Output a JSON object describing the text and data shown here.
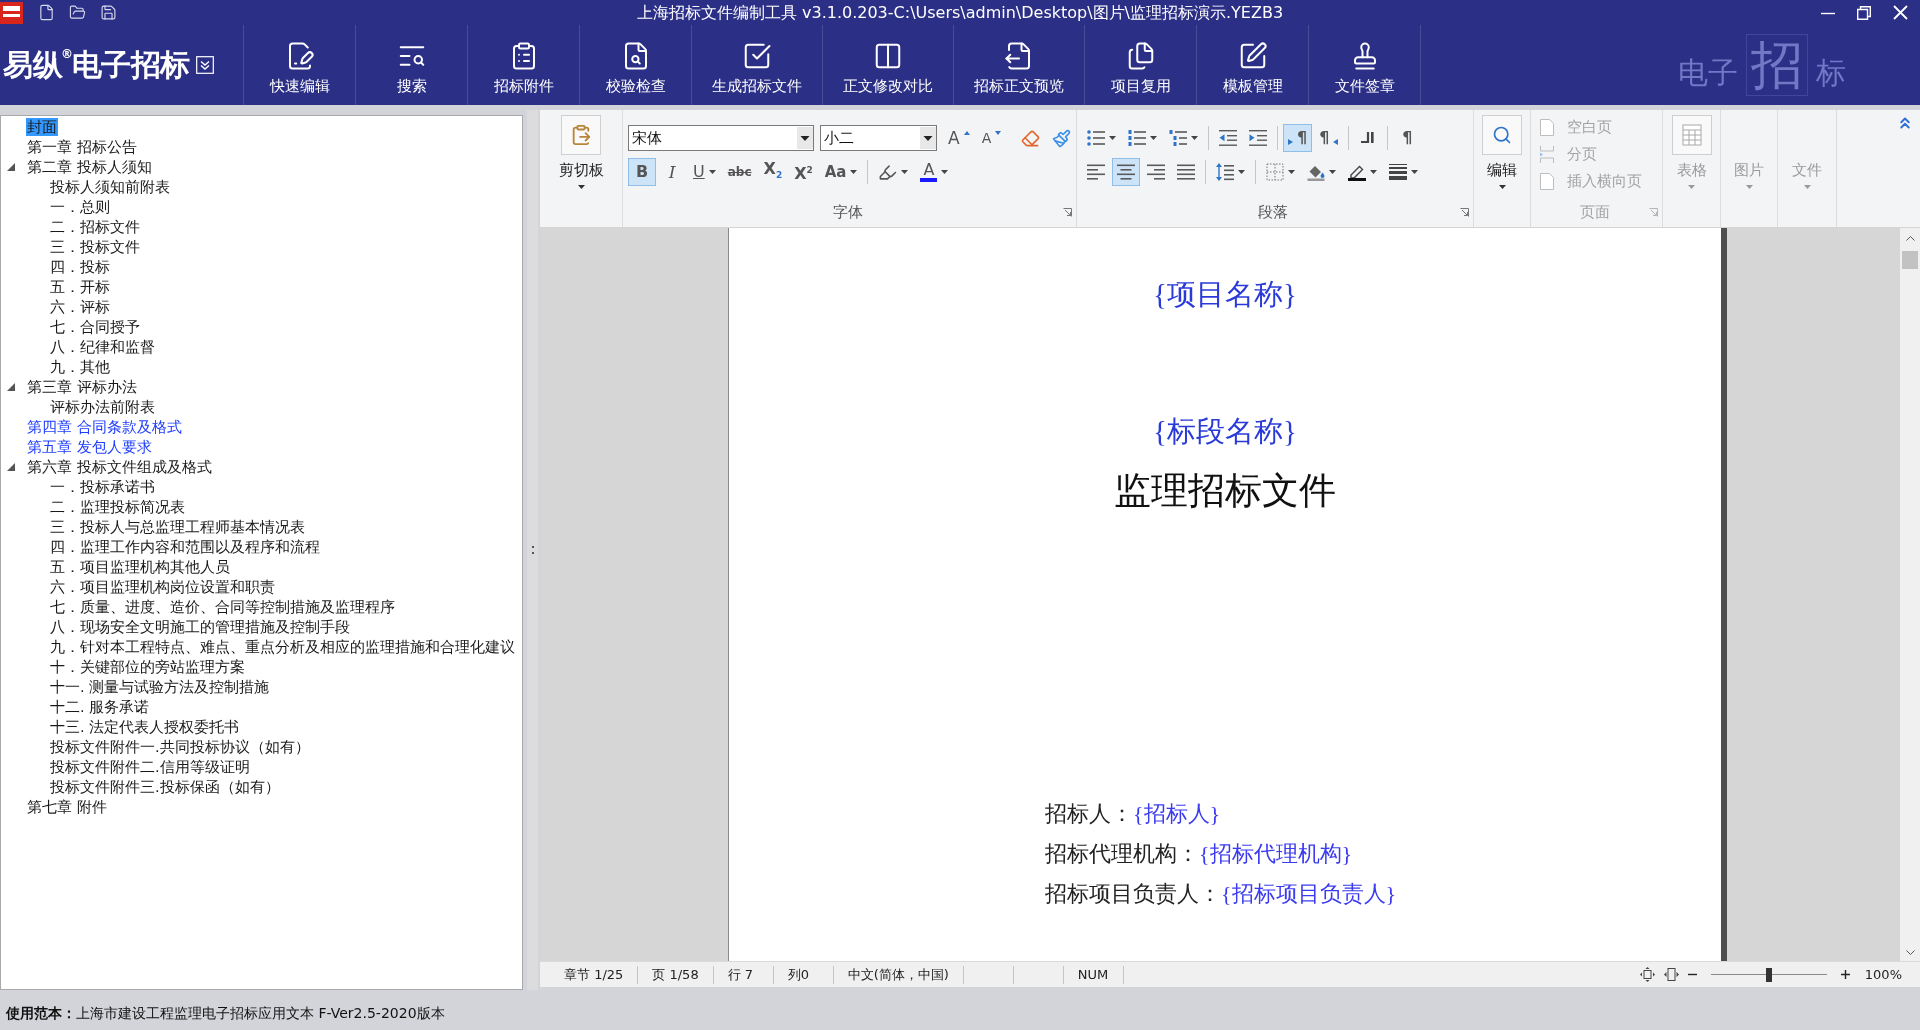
{
  "window": {
    "title": "上海招标文件编制工具 v3.1.0.203-C:\\Users\\admin\\Desktop\\图片\\监理招标演示.YEZB3"
  },
  "brand": {
    "name": "易纵$^{®}$电子招标",
    "mark": [
      "电子",
      "招",
      "标"
    ]
  },
  "toolbar": [
    {
      "kind": "quick-edit",
      "label": "快速编辑"
    },
    {
      "kind": "search",
      "label": "搜索"
    },
    {
      "kind": "attachment",
      "label": "招标附件"
    },
    {
      "kind": "check",
      "label": "校验检查"
    },
    {
      "kind": "generate",
      "label": "生成招标文件"
    },
    {
      "kind": "compare",
      "label": "正文修改对比"
    },
    {
      "kind": "preview",
      "label": "招标正文预览"
    },
    {
      "kind": "reuse",
      "label": "项目复用"
    },
    {
      "kind": "template",
      "label": "模板管理"
    },
    {
      "kind": "sign",
      "label": "文件签章"
    }
  ],
  "tree": {
    "items": [
      {
        "label": "封面",
        "selected": true
      },
      {
        "label": "第一章 招标公告",
        "selected": false
      },
      {
        "label": "第二章 投标人须知",
        "selected": false,
        "expanded": true,
        "children": [
          {
            "label": "投标人须知前附表",
            "selected": false
          },
          {
            "label": "一．总则",
            "selected": false
          },
          {
            "label": "二．招标文件",
            "selected": false
          },
          {
            "label": "三．投标文件",
            "selected": false
          },
          {
            "label": "四．投标",
            "selected": false
          },
          {
            "label": "五．开标",
            "selected": false
          },
          {
            "label": "六．评标",
            "selected": false
          },
          {
            "label": "七．合同授予",
            "selected": false
          },
          {
            "label": "八．纪律和监督",
            "selected": false
          },
          {
            "label": "九．其他",
            "selected": false
          }
        ]
      },
      {
        "label": "第三章 评标办法",
        "selected": false,
        "expanded": true,
        "children": [
          {
            "label": "评标办法前附表",
            "selected": false
          }
        ]
      },
      {
        "label": "第四章 合同条款及格式",
        "selected": false,
        "color": "#1e3cff"
      },
      {
        "label": "第五章 发包人要求",
        "selected": false,
        "color": "#1e3cff"
      },
      {
        "label": "第六章 投标文件组成及格式",
        "selected": false,
        "expanded": true,
        "children": [
          {
            "label": "一．投标承诺书",
            "selected": false
          },
          {
            "label": "二．监理投标简况表",
            "selected": false
          },
          {
            "label": "三．投标人与总监理工程师基本情况表",
            "selected": false
          },
          {
            "label": "四．监理工作内容和范围以及程序和流程",
            "selected": false
          },
          {
            "label": "五．项目监理机构其他人员",
            "selected": false
          },
          {
            "label": "六．项目监理机构岗位设置和职责",
            "selected": false
          },
          {
            "label": "七．质量、进度、造价、合同等控制措施及监理程序",
            "selected": false
          },
          {
            "label": "八．现场安全文明施工的管理措施及控制手段",
            "selected": false
          },
          {
            "label": "九．针对本工程特点、难点、重点分析及相应的监理措施和合理化建议",
            "selected": false
          },
          {
            "label": "十．关键部位的旁站监理方案",
            "selected": false
          },
          {
            "label": "十一. 测量与试验方法及控制措施",
            "selected": false
          },
          {
            "label": "十二. 服务承诺",
            "selected": false
          },
          {
            "label": "十三. 法定代表人授权委托书",
            "selected": false
          },
          {
            "label": "投标文件附件一.共同投标协议（如有）",
            "selected": false
          },
          {
            "label": "投标文件附件二.信用等级证明",
            "selected": false
          },
          {
            "label": "投标文件附件三.投标保函（如有）",
            "selected": false
          }
        ]
      },
      {
        "label": "第七章 附件",
        "selected": false
      }
    ]
  },
  "ribbon": {
    "groups": [
      {
        "kind": "clipboard",
        "label": "剪切板",
        "disabled": false
      },
      {
        "kind": "font",
        "title": "字体",
        "rows": [
          [
            [
              {
                "kind": "font-name",
                "value": "宋体"
              },
              {
                "kind": "font-size",
                "value": "小二"
              },
              {
                "kind": "grow",
                "glyph": "A",
                "selected": false
              },
              {
                "kind": "shrink",
                "glyph": "A",
                "selected": false
              }
            ],
            [
              {
                "kind": "clear-format",
                "selected": false
              },
              {
                "kind": "format-painter",
                "selected": false
              }
            ]
          ],
          [
            [
              {
                "kind": "bold",
                "glyph": "B",
                "selected": true
              },
              {
                "kind": "italic",
                "glyph": "I",
                "selected": false
              },
              {
                "kind": "underline",
                "glyph": "U",
                "selected": false,
                "dropdown": true
              },
              {
                "kind": "strikethrough",
                "glyph": "abc",
                "selected": false
              },
              {
                "kind": "subscript",
                "glyph": "X$_{2}$",
                "selected": false
              },
              {
                "kind": "superscript",
                "glyph": "X$^{2}$",
                "selected": false
              },
              {
                "kind": "change-case",
                "glyph": "Aa",
                "selected": false,
                "dropdown": true
              }
            ],
            [
              {
                "kind": "highlight",
                "selected": false,
                "dropdown": true
              },
              {
                "kind": "font-color",
                "glyph": "A",
                "selected": false,
                "dropdown": true
              }
            ]
          ]
        ]
      },
      {
        "kind": "paragraph",
        "title": "段落",
        "rows": [
          [
            [
              {
                "kind": "bullets",
                "selected": false,
                "dropdown": true
              },
              {
                "kind": "numbering",
                "selected": false,
                "dropdown": true
              },
              {
                "kind": "multilevel",
                "selected": false,
                "dropdown": true
              }
            ],
            [
              {
                "kind": "outdent",
                "selected": false
              },
              {
                "kind": "indent",
                "selected": false
              }
            ],
            [
              {
                "kind": "ltr",
                "glyph": "¶",
                "selected": true
              },
              {
                "kind": "rtl",
                "glyph": "¶",
                "selected": false
              }
            ],
            [
              {
                "kind": "column-break",
                "selected": false
              }
            ],
            [
              {
                "kind": "show-marks",
                "glyph": "¶",
                "selected": false
              }
            ]
          ],
          [
            [
              {
                "kind": "align-left",
                "selected": false
              },
              {
                "kind": "align-center",
                "selected": true
              },
              {
                "kind": "align-right",
                "selected": false
              },
              {
                "kind": "justify",
                "selected": false
              }
            ],
            [
              {
                "kind": "line-spacing",
                "selected": false,
                "dropdown": true
              }
            ],
            [
              {
                "kind": "borders",
                "selected": false,
                "dropdown": true
              },
              {
                "kind": "shading",
                "selected": false,
                "dropdown": true
              },
              {
                "kind": "border-color",
                "selected": false,
                "dropdown": true
              },
              {
                "kind": "line-style",
                "selected": false,
                "dropdown": true
              }
            ]
          ]
        ]
      },
      {
        "kind": "edit",
        "label": "编辑",
        "disabled": false
      },
      {
        "kind": "page",
        "title": "页面",
        "disabled": true,
        "items": [
          {
            "kind": "blank-page",
            "label": "空白页"
          },
          {
            "kind": "page-break",
            "label": "分页"
          },
          {
            "kind": "landscape-page",
            "label": "插入横向页"
          }
        ]
      },
      {
        "kind": "table",
        "label": "表格",
        "disabled": true
      },
      {
        "kind": "picture",
        "label": "图片",
        "disabled": true
      },
      {
        "kind": "file",
        "label": "文件",
        "disabled": true
      }
    ]
  },
  "document": {
    "project": "{项目名称}",
    "section": "{标段名称}",
    "title": "监理招标文件",
    "fields": [
      {
        "label": "招标人：",
        "value": "{招标人}"
      },
      {
        "label": "招标代理机构：",
        "value": "{招标代理机构}"
      },
      {
        "label": "招标项目负责人：",
        "value": "{招标项目负责人}"
      }
    ]
  },
  "status_bar": {
    "cells": [
      {
        "kind": "text",
        "text": "章节 1/25"
      },
      {
        "kind": "text",
        "text": "页 1/58"
      },
      {
        "kind": "text",
        "text": "行 7"
      },
      {
        "kind": "text",
        "text": "列0"
      },
      {
        "kind": "text",
        "text": "中文(简体，中国)"
      },
      {
        "kind": "blank"
      },
      {
        "kind": "blank"
      },
      {
        "kind": "text",
        "text": "NUM"
      }
    ],
    "zoom": {
      "level": 0.5,
      "reading": "100%"
    }
  },
  "footer": {
    "text": "**使用范本：**上海市建设工程监理电子招标应用文本  F-Ver2.5-2020版本"
  }
}
